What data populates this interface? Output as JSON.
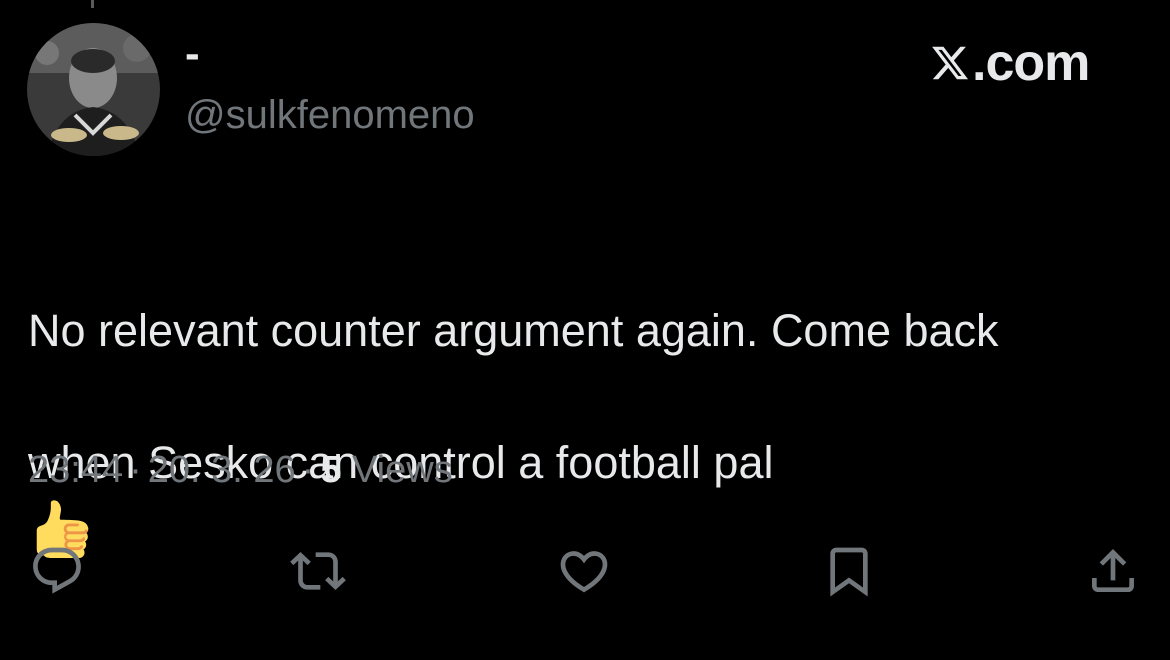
{
  "author": {
    "display_name": "-",
    "handle": "@sulkfenomeno"
  },
  "watermark": {
    "text": ".com",
    "icon": "x-logo-icon"
  },
  "tweet": {
    "text_line1": "No relevant counter argument again. Come back",
    "text_line2": "when Sesko can control a football pal",
    "emoji": "thumbs-up-icon"
  },
  "meta": {
    "time": "23:44",
    "separator": "·",
    "date": "20. 3. 26",
    "views_count": "5",
    "views_label": "Views"
  },
  "actions": [
    {
      "name": "reply",
      "icon": "reply-icon"
    },
    {
      "name": "repost",
      "icon": "repost-icon"
    },
    {
      "name": "like",
      "icon": "heart-icon"
    },
    {
      "name": "bookmark",
      "icon": "bookmark-icon"
    },
    {
      "name": "share",
      "icon": "share-icon"
    }
  ],
  "colors": {
    "background": "#000000",
    "primary_text": "#e7e9ea",
    "secondary_text": "#71767b"
  }
}
